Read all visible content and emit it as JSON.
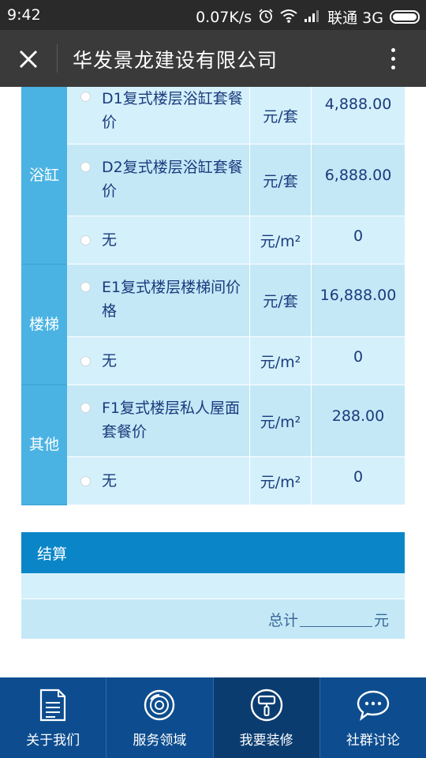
{
  "status_bar": {
    "time": "9:42",
    "speed": "0.07K/s",
    "carrier": "联通 3G"
  },
  "header": {
    "title": "华发景龙建设有限公司"
  },
  "groups": [
    {
      "label": "浴缸",
      "rows": [
        {
          "name": "D1复式楼层浴缸套餐价",
          "unit": "元/套",
          "price": "4,888.00"
        },
        {
          "name": "D2复式楼层浴缸套餐价",
          "unit": "元/套",
          "price": "6,888.00"
        },
        {
          "name": "无",
          "unit": "元/m²",
          "price": "0"
        }
      ]
    },
    {
      "label": "楼梯",
      "rows": [
        {
          "name": "E1复式楼层楼梯间价格",
          "unit": "元/套",
          "price": "16,888.00"
        },
        {
          "name": "无",
          "unit": "元/m²",
          "price": "0"
        }
      ]
    },
    {
      "label": "其他",
      "rows": [
        {
          "name": "F1复式楼层私人屋面套餐价",
          "unit": "元/m²",
          "price": "288.00"
        },
        {
          "name": "无",
          "unit": "元/m²",
          "price": "0"
        }
      ]
    }
  ],
  "summary": {
    "header": "结算",
    "total_label": "总计",
    "total_unit": "元"
  },
  "nav": [
    {
      "label": "关于我们",
      "icon": "document-icon"
    },
    {
      "label": "服务领域",
      "icon": "disc-icon"
    },
    {
      "label": "我要装修",
      "icon": "paint-roller-icon"
    },
    {
      "label": "社群讨论",
      "icon": "chat-bubble-icon"
    }
  ],
  "colors": {
    "group_label_bg": "#4ab3e3",
    "row_light": "#d4f0fb",
    "row_dark": "#c4e8f6",
    "summary_header": "#0a86c8",
    "nav_bg": "#0d4d8f",
    "nav_active": "#0b3c70"
  }
}
